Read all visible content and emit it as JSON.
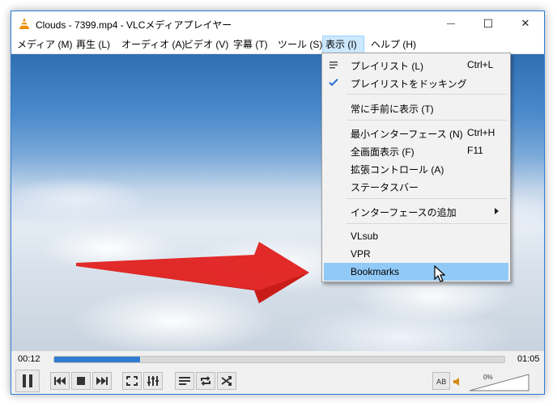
{
  "window": {
    "title": "Clouds - 7399.mp4 - VLCメディアプレイヤー",
    "minimize_glyph": "—",
    "maximize_glyph": "☐",
    "close_glyph": "✕"
  },
  "menubar": {
    "items": [
      {
        "label": "メディア (M)"
      },
      {
        "label": "再生 (L)"
      },
      {
        "label": "オーディオ (A)"
      },
      {
        "label": "ビデオ (V)"
      },
      {
        "label": "字幕 (T)"
      },
      {
        "label": "ツール (S)"
      },
      {
        "label": "表示 (I)",
        "active": true
      },
      {
        "label": "ヘルプ (H)"
      }
    ]
  },
  "view_menu": {
    "items": [
      {
        "label": "プレイリスト (L)",
        "shortcut": "Ctrl+L",
        "icon": "playlist-icon"
      },
      {
        "label": "プレイリストをドッキング",
        "checked": true,
        "icon": "checkmark-icon"
      },
      {
        "label": "常に手前に表示 (T)"
      },
      {
        "label": "最小インターフェース (N)",
        "shortcut": "Ctrl+H"
      },
      {
        "label": "全画面表示 (F)",
        "shortcut": "F11"
      },
      {
        "label": "拡張コントロール (A)"
      },
      {
        "label": "ステータスバー"
      },
      {
        "label": "インターフェースの追加",
        "submenu": true
      },
      {
        "label": "VLsub"
      },
      {
        "label": "VPR"
      },
      {
        "label": "Bookmarks",
        "highlighted": true
      }
    ]
  },
  "player": {
    "elapsed": "00:12",
    "total": "01:05",
    "progress_fraction": 0.19,
    "volume_label": "0%",
    "volume_fraction": 0.0,
    "accent_color": "#2e7bd1"
  },
  "overlay": {
    "arrow_color": "#e0201e",
    "arrow_target": "Bookmarks"
  }
}
